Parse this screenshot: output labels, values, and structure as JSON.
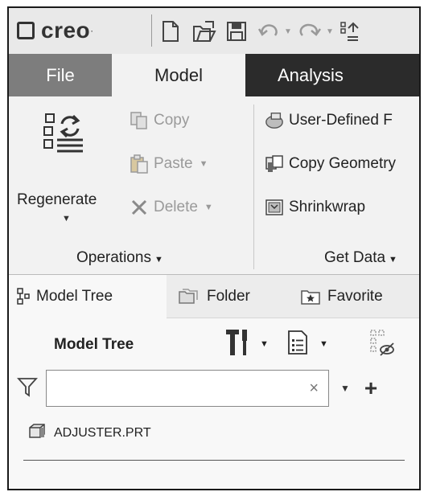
{
  "app": {
    "logo_text": "creo",
    "logo_mark": "·"
  },
  "quick_access": {
    "icons": [
      "new-file-icon",
      "open-file-icon",
      "save-icon",
      "undo-icon",
      "redo-icon",
      "regenerate-small-icon"
    ]
  },
  "ribbon_tabs": [
    {
      "label": "File"
    },
    {
      "label": "Model"
    },
    {
      "label": "Analysis"
    }
  ],
  "ribbon": {
    "regenerate_label": "Regenerate",
    "copy_label": "Copy",
    "paste_label": "Paste",
    "delete_label": "Delete",
    "operations_label": "Operations",
    "user_defined_label": "User-Defined F",
    "copy_geometry_label": "Copy Geometry",
    "shrinkwrap_label": "Shrinkwrap",
    "get_data_label": "Get Data"
  },
  "panel_tabs": [
    {
      "label": "Model Tree"
    },
    {
      "label": "Folder"
    },
    {
      "label": "Favorite"
    }
  ],
  "model_tree": {
    "title": "Model Tree",
    "filter_value": "",
    "items": [
      {
        "label": "ADJUSTER.PRT"
      }
    ]
  },
  "colors": {
    "tab_bar_dark": "#2b2b2b",
    "file_tab": "#7d7d7d",
    "active_tab": "#f2f2f2",
    "disabled_text": "#9a9a9a"
  }
}
